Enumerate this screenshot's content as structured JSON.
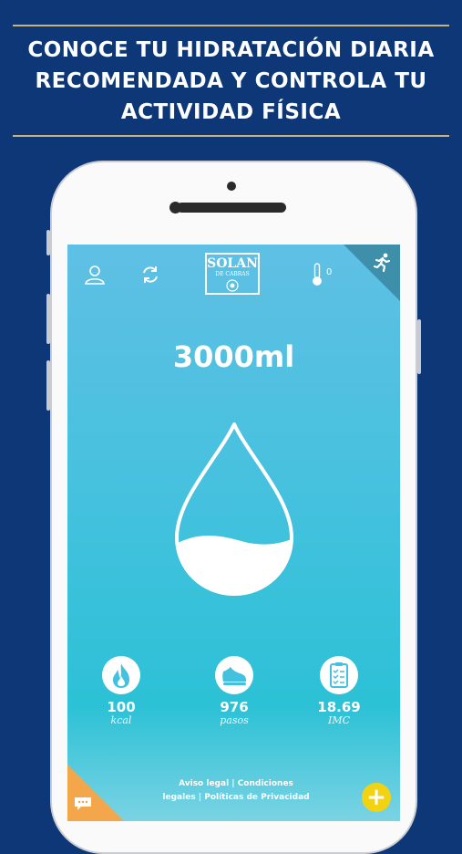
{
  "promo": {
    "line1": "CONOCE TU HIDRATACIÓN DIARIA",
    "line2": "RECOMENDADA Y CONTROLA TU",
    "line3": "ACTIVIDAD FÍSICA"
  },
  "header": {
    "logo_line1": "SOLAN",
    "logo_line2": "DE CABRAS",
    "temperature": "0",
    "icons": [
      "user-icon",
      "sync-icon",
      "thermometer-icon",
      "running-icon"
    ]
  },
  "hydration": {
    "amount": "3000ml",
    "fill_fraction": 0.28
  },
  "stats": [
    {
      "value": "100",
      "unit": "kcal",
      "icon": "flame-icon"
    },
    {
      "value": "976",
      "unit": "pasos",
      "icon": "shoe-icon"
    },
    {
      "value": "18.69",
      "unit": "IMC",
      "icon": "clipboard-icon"
    }
  ],
  "footer": {
    "links_line1": "Aviso legal | Condiciones",
    "links_line2": "legales | Políticas de Privacidad",
    "plus_label": "+"
  },
  "colors": {
    "background": "#0d3776",
    "accent_rule": "#c9b27a",
    "plus_button": "#f2d313",
    "chat_corner": "#f3a64a"
  }
}
